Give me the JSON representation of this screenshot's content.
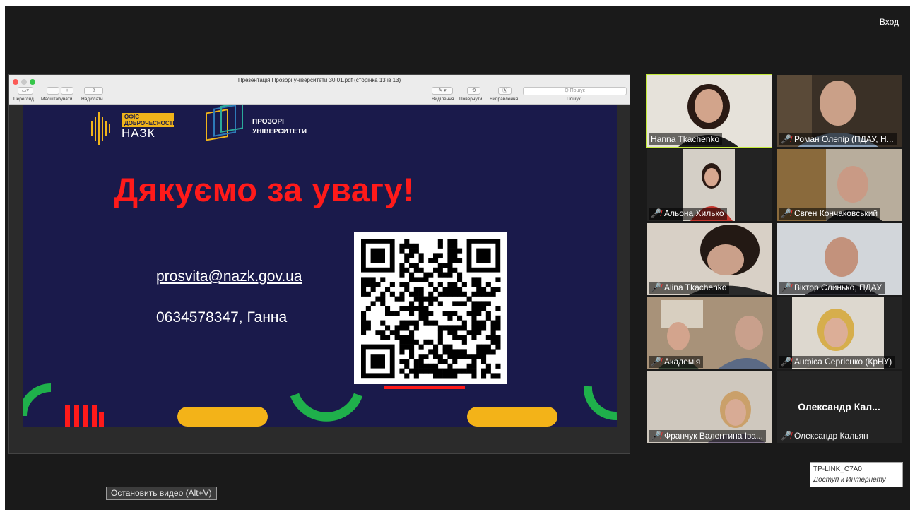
{
  "header": {
    "enter_label": "Вход"
  },
  "preview": {
    "title": "Презентація Прозорі університети 30 01.pdf (сторінка 13 із 13)",
    "toolbar": [
      {
        "label": "Перегляд",
        "icon": "sidebar-icon"
      },
      {
        "label": "Масштабувати",
        "icon": "zoom-icon"
      },
      {
        "label": "Надіслати",
        "icon": "share-icon"
      },
      {
        "label": "Виділення",
        "icon": "highlight-icon"
      },
      {
        "label": "Повернути",
        "icon": "rotate-icon"
      },
      {
        "label": "Виправлення",
        "icon": "markup-icon"
      },
      {
        "label": "Пошук",
        "icon": "search-icon"
      }
    ],
    "search_placeholder": "Q Пошук"
  },
  "slide": {
    "office_badge": "ОФІС ДОБРОЧЕСНОСТІ",
    "org_name": "НАЗК",
    "project_name": "ПРОЗОРІ УНІВЕРСИТЕТИ",
    "thanks": "Дякуємо за увагу!",
    "email": "prosvita@nazk.gov.ua",
    "phone": "0634578347, Ганна",
    "colors": {
      "background": "#1a1a4b",
      "accent_red": "#ff1a1a",
      "accent_yellow": "#f3b318",
      "accent_green": "#1fb04b"
    }
  },
  "participants": [
    {
      "name": "Hanna Tkachenko",
      "muted": false,
      "active": true
    },
    {
      "name": "Роман Олепір (ПДАУ, Н...",
      "muted": true
    },
    {
      "name": "Альона Хилько",
      "muted": true
    },
    {
      "name": "Євген Кончаковський",
      "muted": true
    },
    {
      "name": "Alina Tkachenko",
      "muted": true
    },
    {
      "name": "Віктор Слинько, ПДАУ",
      "muted": true
    },
    {
      "name": "Академія",
      "muted": true
    },
    {
      "name": "Анфіса Сергієнко (КрНУ)",
      "muted": true
    },
    {
      "name": "Франчук Валентина Іва...",
      "muted": true
    },
    {
      "name": "Олександр Кальян",
      "muted": true,
      "video_off_name": "Олександр Кал..."
    }
  ],
  "footer": {
    "stop_video": "Остановить видео (Alt+V)",
    "network_name": "TP-LINK_C7A0",
    "network_status": "Доступ к Интернету"
  }
}
